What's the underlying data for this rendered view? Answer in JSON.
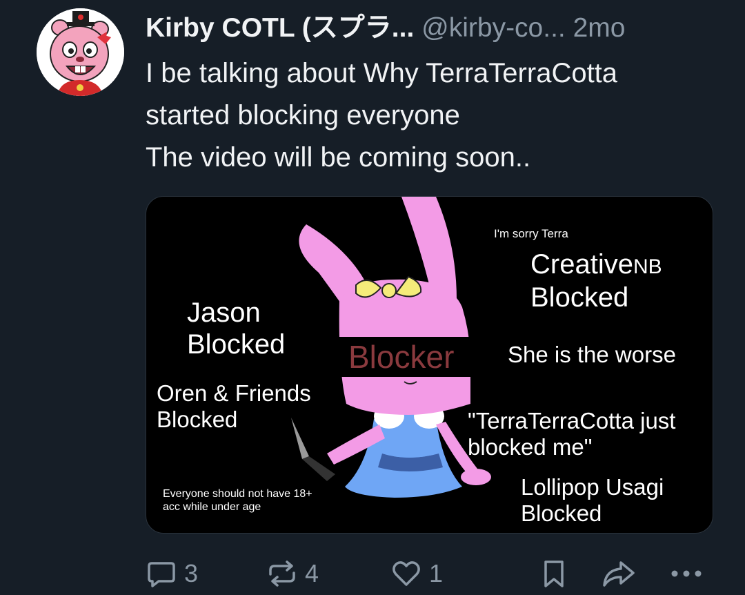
{
  "post": {
    "author": {
      "display_name": "Kirby COTL (スプラ...",
      "handle": "@kirby-co...",
      "avatar_icon": "pink-character-avatar"
    },
    "separator": " ",
    "time": "2mo",
    "text_lines": [
      "I be talking about Why TerraTerraCotta",
      "started blocking everyone",
      "The video will be coming soon.."
    ],
    "image": {
      "captions": {
        "sorry": "I'm sorry Terra",
        "creative_name": "Creative",
        "creative_suffix": "NB",
        "creative_status": "Blocked",
        "jason_name": "Jason",
        "jason_status": "Blocked",
        "blocker": "Blocker",
        "worse": "She is the worse",
        "oren_name": "Oren & Friends",
        "oren_status": "Blocked",
        "quote_line1": "\"TerraTerraCotta just",
        "quote_line2": "blocked me\"",
        "everyone_line1": "Everyone should not have 18+",
        "everyone_line2": "acc while under age",
        "lollipop_name": "Lollipop Usagi",
        "lollipop_status": "Blocked"
      }
    }
  },
  "actions": {
    "reply": {
      "icon": "reply-bubble-icon",
      "count": "3"
    },
    "repost": {
      "icon": "repost-arrows-icon",
      "count": "4"
    },
    "like": {
      "icon": "heart-icon",
      "count": "1"
    },
    "bookmark": {
      "icon": "bookmark-icon"
    },
    "share": {
      "icon": "share-arrow-icon"
    },
    "more": {
      "icon": "more-dots-icon"
    }
  },
  "colors": {
    "background": "#161e27",
    "text": "#f1f3f5",
    "muted": "#8b98a5",
    "bunny_pink": "#f39be6",
    "bow_yellow": "#f5ec7a",
    "dress_blue": "#6fa6f5",
    "blocker_red": "#8a3a3e"
  }
}
